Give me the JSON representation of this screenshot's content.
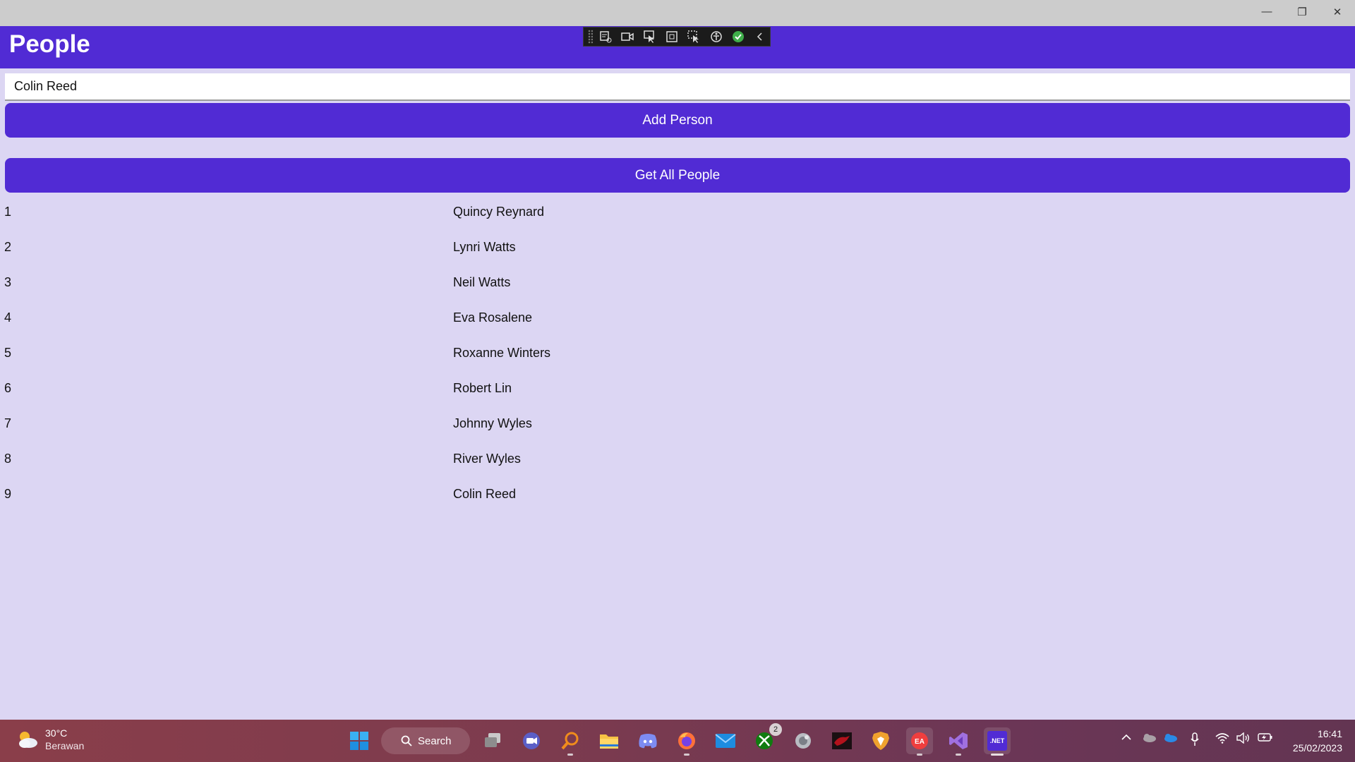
{
  "window": {
    "minimize_glyph": "—",
    "maximize_glyph": "❐",
    "close_glyph": "✕"
  },
  "app": {
    "title": "People"
  },
  "form": {
    "name_value": "Colin Reed",
    "add_label": "Add Person",
    "get_label": "Get All People"
  },
  "people": [
    {
      "id": "1",
      "name": "Quincy Reynard"
    },
    {
      "id": "2",
      "name": "Lynri Watts"
    },
    {
      "id": "3",
      "name": "Neil Watts"
    },
    {
      "id": "4",
      "name": "Eva Rosalene"
    },
    {
      "id": "5",
      "name": "Roxanne Winters"
    },
    {
      "id": "6",
      "name": "Robert Lin"
    },
    {
      "id": "7",
      "name": "Johnny Wyles"
    },
    {
      "id": "8",
      "name": "River Wyles"
    },
    {
      "id": "9",
      "name": "Colin Reed"
    }
  ],
  "taskbar": {
    "weather_temp": "30°C",
    "weather_condition": "Berawan",
    "search_label": "Search",
    "xbox_badge": "2",
    "dotnet_label": ".NET",
    "time": "16:41",
    "date": "25/02/2023"
  },
  "colors": {
    "accent": "#512bd4",
    "background": "#dcd6f3",
    "titlebar": "#cccccc"
  }
}
